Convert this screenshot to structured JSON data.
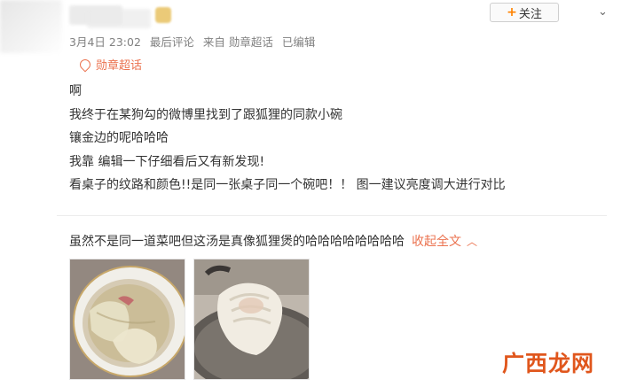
{
  "header": {
    "follow_label": "关注",
    "menu_caret": "⌄"
  },
  "meta": {
    "date": "3月4日 23:02",
    "last_comment": "最后评论",
    "source": "来自 勋章超话",
    "edited": "已编辑"
  },
  "topic": {
    "label": "勋章超话"
  },
  "post": {
    "lines": [
      "啊",
      "我终于在某狗勾的微博里找到了跟狐狸的同款小碗",
      "镶金边的呢哈哈哈",
      "我靠 编辑一下仔细看后又有新发现!",
      "看桌子的纹路和颜色!!是同一张桌子同一个碗吧！！ 图一建议亮度调大进行对比"
    ]
  },
  "comment": {
    "text": "虽然不是同一道菜吧但这汤是真像狐狸煲的哈哈哈哈哈哈哈哈",
    "collapse_label": "收起全文",
    "collapse_icon": "chevron-up"
  },
  "watermark": {
    "text": "广西龙网"
  },
  "colors": {
    "accent": "#eb7350",
    "follow_plus": "#ff8200",
    "meta_gray": "#808080",
    "watermark": "#e0561c"
  }
}
